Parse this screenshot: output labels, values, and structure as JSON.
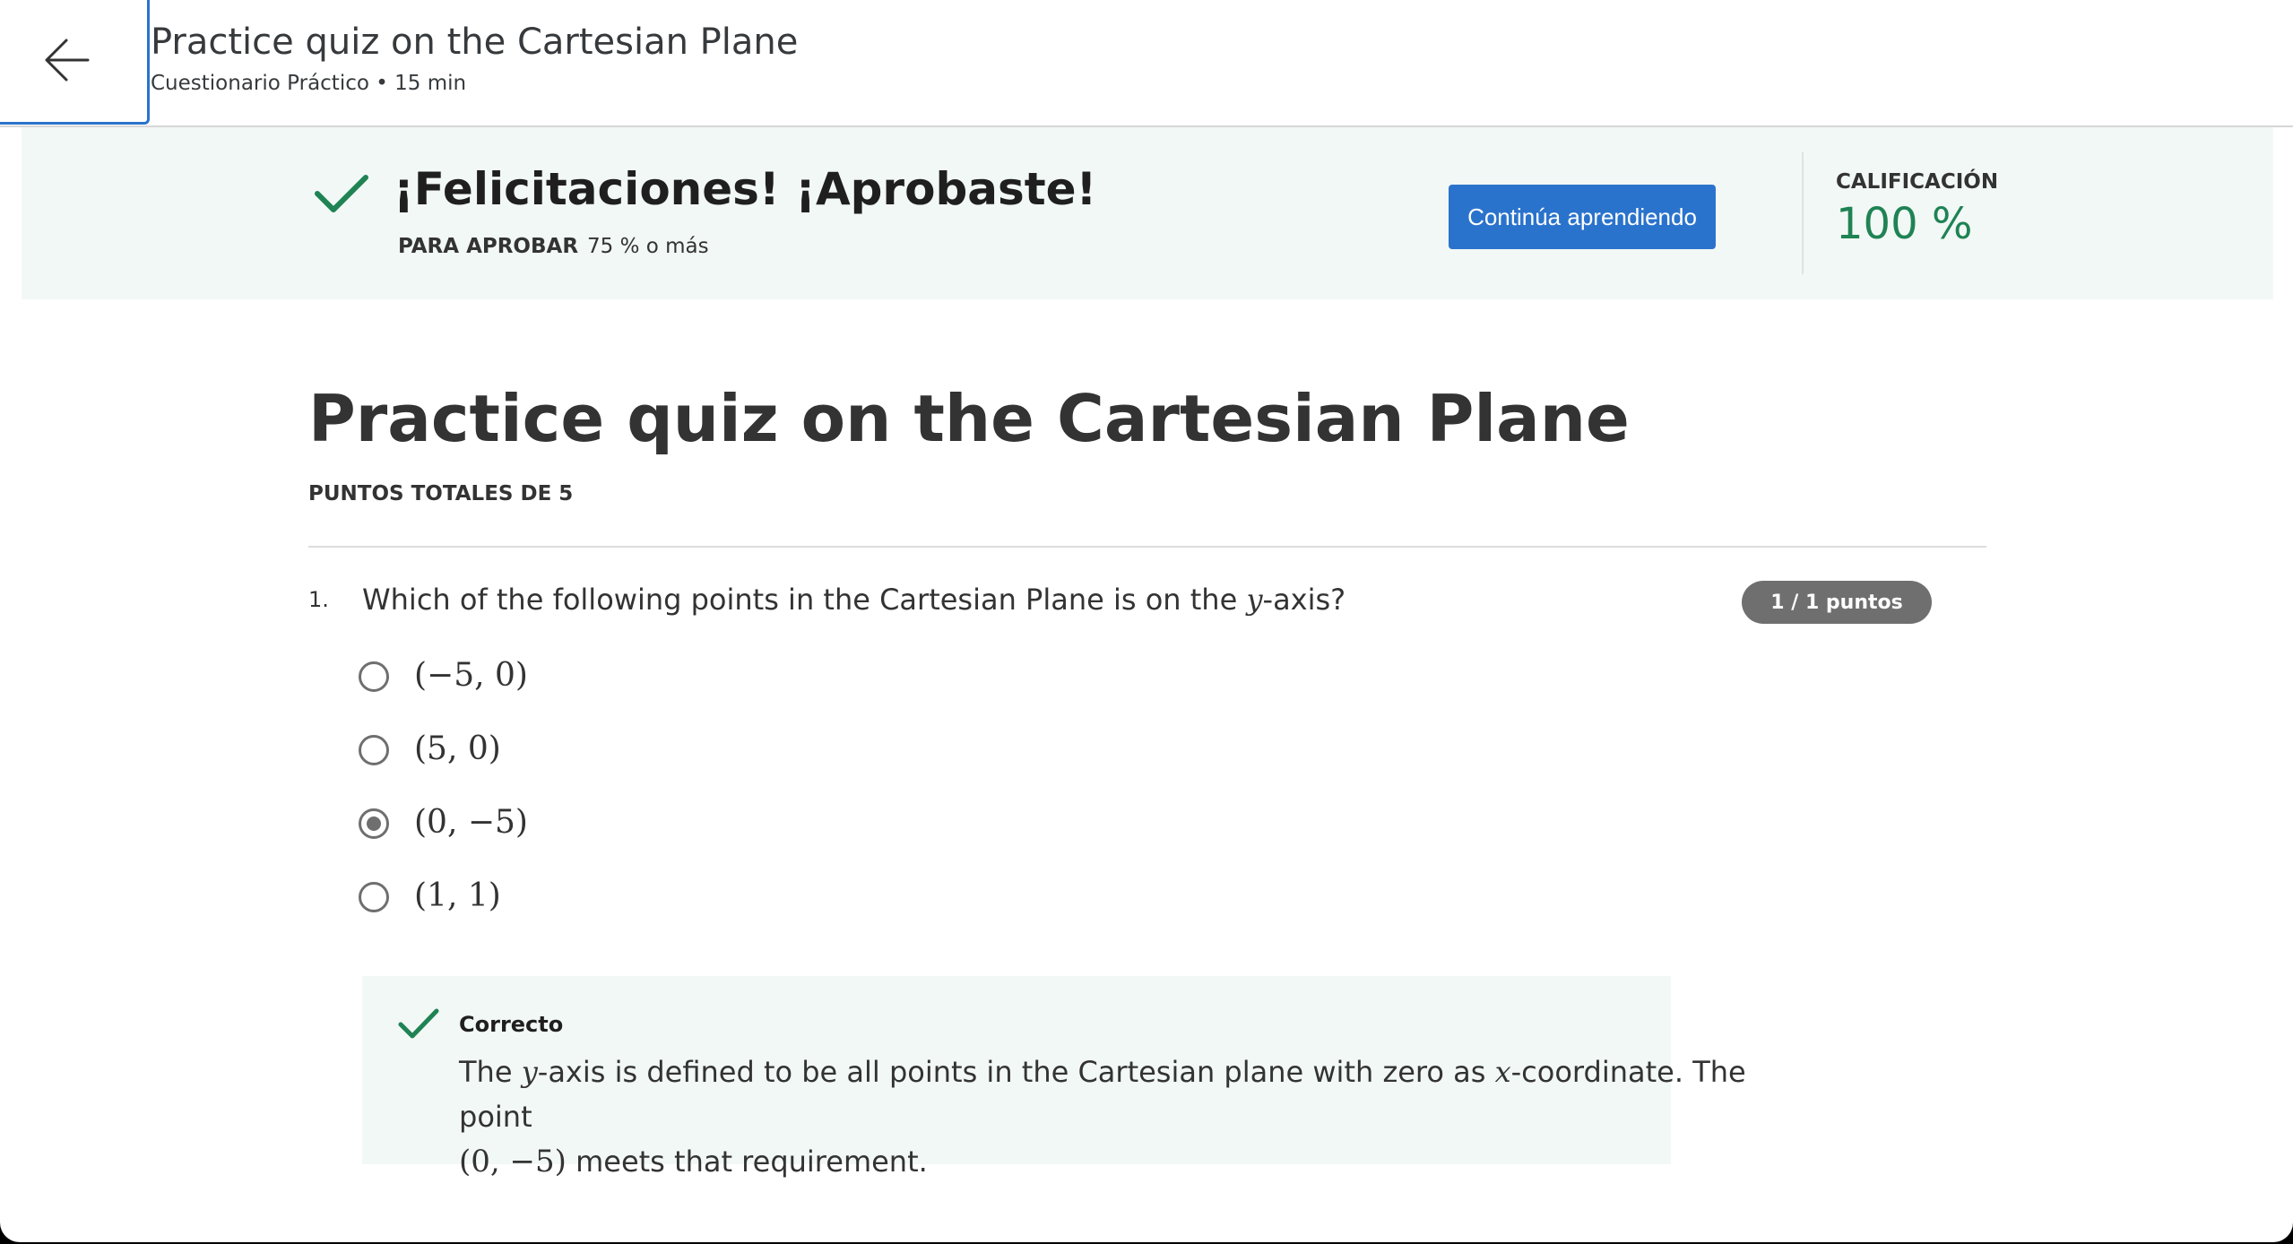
{
  "header": {
    "title": "Practice quiz on the Cartesian Plane",
    "subtitle": "Cuestionario Práctico • 15 min"
  },
  "banner": {
    "heading": "¡Felicitaciones! ¡Aprobaste!",
    "pass_label": "PARA APROBAR",
    "pass_value": "75 % o más",
    "continue_label": "Continúa aprendiendo",
    "grade_label": "CALIFICACIÓN",
    "grade_value": "100 %"
  },
  "quiz": {
    "title": "Practice quiz on the Cartesian Plane",
    "total_points": "PUNTOS TOTALES DE 5"
  },
  "question": {
    "number": "1.",
    "text_before": "Which of the following points in the Cartesian Plane is on the ",
    "text_var": "y",
    "text_after": "-axis?",
    "points_badge": "1 / 1 puntos",
    "options": [
      {
        "label": "(−5, 0)",
        "selected": false
      },
      {
        "label": "(5, 0)",
        "selected": false
      },
      {
        "label": "(0, −5)",
        "selected": true
      },
      {
        "label": "(1, 1)",
        "selected": false
      }
    ]
  },
  "feedback": {
    "label": "Correcto",
    "part1": "The ",
    "var_y": "y",
    "part2": "-axis is defined to be all points in the Cartesian plane with zero as ",
    "var_x": "x",
    "part3": "-coordinate. The point ",
    "point": "(0, −5)",
    "part4": " meets that requirement."
  },
  "colors": {
    "accent": "#2a73cc",
    "success": "#1f8354",
    "banner_bg": "#f2f8f6",
    "badge_bg": "#6f6f6f"
  },
  "icons": {
    "back": "arrow-left-icon",
    "banner_check": "checkmark-icon",
    "feedback_check": "checkmark-icon"
  }
}
